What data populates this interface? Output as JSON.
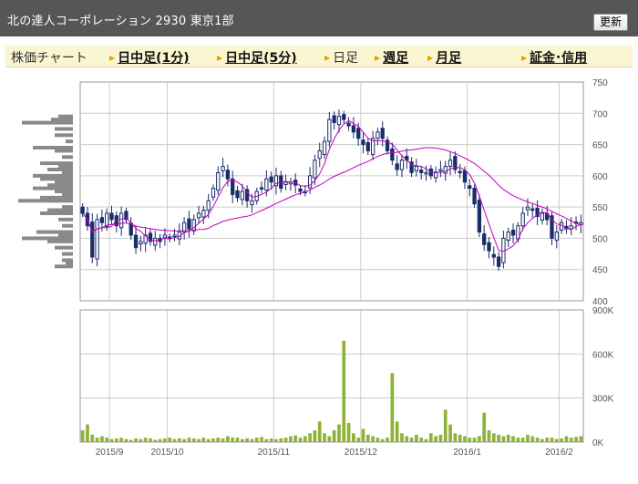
{
  "header": {
    "title": "北の達人コーポレーション 2930 東京1部",
    "refresh_label": "更新"
  },
  "tabs": [
    {
      "label": "株価チャート",
      "kind": "heading"
    },
    {
      "label": "日中足(1分)",
      "kind": "link"
    },
    {
      "label": "日中足(5分)",
      "kind": "link"
    },
    {
      "label": "日足",
      "kind": "current"
    },
    {
      "label": "週足",
      "kind": "link"
    },
    {
      "label": "月足",
      "kind": "link"
    },
    {
      "label": "証金･信用",
      "kind": "link"
    }
  ],
  "colors": {
    "up_candle": "#3a70c8",
    "down_candle": "#1a2d6a",
    "moving_average": "#c000c0",
    "volume_bar": "#8fb23a",
    "volume_profile": "#8a8a8a",
    "grid": "#cccccc",
    "title_bar": "#565656",
    "tab_bar": "#fbf6d2"
  },
  "chart_data": [
    {
      "type": "candlestick",
      "title": "",
      "y_ticks": [
        400,
        450,
        500,
        550,
        600,
        650,
        700,
        750
      ],
      "ylim": [
        400,
        750
      ],
      "x_ticks": [
        "2015/9",
        "2015/10",
        "2015/11",
        "2015/12",
        "2016/1",
        "2016/2"
      ],
      "grid": true,
      "closes": [
        540,
        520,
        470,
        530,
        525,
        540,
        530,
        520,
        540,
        530,
        505,
        485,
        495,
        505,
        495,
        500,
        495,
        505,
        500,
        505,
        510,
        525,
        515,
        530,
        540,
        545,
        560,
        580,
        605,
        615,
        595,
        570,
        565,
        575,
        560,
        560,
        575,
        580,
        595,
        590,
        600,
        580,
        590,
        590,
        585,
        575,
        575,
        600,
        625,
        640,
        655,
        690,
        685,
        695,
        690,
        680,
        670,
        660,
        650,
        640,
        660,
        670,
        660,
        640,
        625,
        610,
        625,
        625,
        605,
        615,
        605,
        605,
        600,
        605,
        610,
        615,
        625,
        610,
        605,
        590,
        580,
        555,
        510,
        490,
        480,
        470,
        455,
        500,
        510,
        505,
        520,
        540,
        550,
        545,
        535,
        540,
        530,
        500,
        510,
        525,
        515,
        520,
        525,
        525
      ]
    },
    {
      "type": "histogram",
      "label": "volume_profile",
      "prices": [
        695,
        690,
        685,
        675,
        665,
        655,
        645,
        640,
        630,
        620,
        615,
        610,
        605,
        600,
        595,
        590,
        585,
        580,
        575,
        570,
        565,
        560,
        550,
        545,
        540,
        530,
        520,
        510,
        505,
        500,
        495,
        485,
        475,
        465,
        460,
        455
      ],
      "values": [
        8,
        12,
        28,
        10,
        10,
        4,
        22,
        10,
        6,
        18,
        8,
        14,
        6,
        22,
        18,
        10,
        14,
        22,
        10,
        6,
        18,
        30,
        6,
        14,
        18,
        8,
        6,
        20,
        8,
        28,
        14,
        10,
        6,
        6,
        4,
        10
      ]
    },
    {
      "type": "bar",
      "title": "",
      "y_ticks": [
        "0K",
        "300K",
        "600K",
        "900K"
      ],
      "ylim": [
        0,
        900
      ],
      "values": [
        80,
        120,
        50,
        30,
        40,
        30,
        20,
        25,
        30,
        20,
        15,
        25,
        20,
        30,
        25,
        15,
        20,
        25,
        30,
        20,
        25,
        20,
        30,
        25,
        20,
        30,
        20,
        25,
        30,
        25,
        40,
        30,
        30,
        20,
        25,
        20,
        30,
        35,
        20,
        25,
        20,
        25,
        30,
        40,
        45,
        30,
        40,
        60,
        80,
        140,
        60,
        40,
        80,
        120,
        690,
        130,
        60,
        30,
        90,
        50,
        40,
        30,
        20,
        30,
        470,
        140,
        60,
        40,
        30,
        50,
        30,
        20,
        60,
        40,
        50,
        220,
        120,
        60,
        50,
        40,
        30,
        30,
        40,
        200,
        80,
        60,
        50,
        40,
        50,
        40,
        30,
        30,
        50,
        40,
        30,
        20,
        30,
        30,
        20,
        25,
        40,
        30,
        35,
        40
      ]
    }
  ]
}
